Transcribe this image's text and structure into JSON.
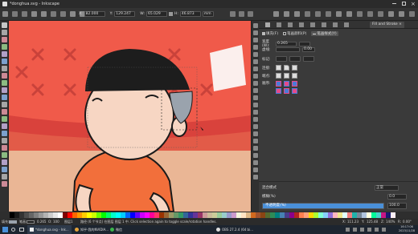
{
  "window": {
    "title": "*donghua.svg - Inkscape"
  },
  "command_bar": {
    "x_label": "X:",
    "x_value": "82.000",
    "y_label": "Y:",
    "y_value": "129.247",
    "w_label": "W:",
    "w_value": "65.029",
    "h_label": "H:",
    "h_value": "46.873",
    "unit": "mm"
  },
  "panel": {
    "tab_label": "Fill and Stroke",
    "fill_tab": "填充(F)",
    "stroke_paint_tab": "笔画颜料(P)",
    "stroke_style_tab": "笔画样式(Y)",
    "width_label": "宽度(W):",
    "width_value": "0.265",
    "dashes_label": "虚线:",
    "dashes_value": "0.00",
    "markers_label": "标记:",
    "join_label": "连接:",
    "cap_label": "端点:",
    "order_label": "顺序:",
    "blur_label": "模糊(%)",
    "blur_value": "0.0",
    "opacity_label": "不透明度(%)",
    "opacity_value": "100.0",
    "opacity_fill": 1.0,
    "blend_label": "混合模式",
    "blend_value": "正常"
  },
  "statusbar": {
    "fill_label": "填充:",
    "stroke_label": "笔画:",
    "stroke_width": "0.265",
    "opacity_label": "O:",
    "opacity_value": "100",
    "layer": "图层1",
    "message": "路径 (6 个节点) 在图层 图层 1 中. Click selection again to toggle scale/rotation handles.",
    "cursor_x_label": "X:",
    "cursor_x": "111.23",
    "cursor_y_label": "Y:",
    "cursor_y": "125.48",
    "zoom_label": "Z:",
    "zoom": "140%",
    "rotation_label": "R:",
    "rotation": "0.00°"
  },
  "taskbar": {
    "items": [
      "*donghua.svg - Ink...",
      "知乎-我的NVIDIA...",
      "微信",
      "OBS 27.2.4 (64 bi..."
    ],
    "time": "16:17:06",
    "date": "2023/11/28"
  },
  "colors": {
    "title_bg": "#2b2b2b",
    "panel_bg": "#3a3a3a",
    "accent": "#4a90d9",
    "wall_red": "#f05a4a",
    "hair": "#1d1d1d",
    "skin": "#f7d6c3",
    "shirt": "#f26f3b"
  },
  "palette_swatches": [
    "#000000",
    "#1a1a1a",
    "#333333",
    "#4d4d4d",
    "#666666",
    "#808080",
    "#999999",
    "#b3b3b3",
    "#cccccc",
    "#e6e6e6",
    "#ffffff",
    "#800000",
    "#ff0000",
    "#ff6600",
    "#ff9900",
    "#ffcc00",
    "#ffff00",
    "#ccff00",
    "#66ff00",
    "#00ff00",
    "#00ff66",
    "#00ffcc",
    "#00ffff",
    "#00ccff",
    "#0066ff",
    "#0000ff",
    "#6600ff",
    "#cc00ff",
    "#ff00ff",
    "#ff0099",
    "#ff3366",
    "#993300",
    "#996633",
    "#999966",
    "#669966",
    "#339966",
    "#336699",
    "#333399",
    "#663399",
    "#993366",
    "#cc9999",
    "#ccbb99",
    "#cccc99",
    "#99cc99",
    "#99cccc",
    "#9999cc",
    "#cc99cc",
    "#f5f5dc",
    "#ffe4c4",
    "#deb887",
    "#d2691e",
    "#a0522d",
    "#8b4513",
    "#556b2f",
    "#2e8b57",
    "#008080",
    "#4682b4",
    "#483d8b",
    "#8b008b",
    "#b22222",
    "#ff7f50",
    "#ffa07a",
    "#ffd700",
    "#adff2f",
    "#7fffd4",
    "#87cefa",
    "#9370db",
    "#ffb6c1",
    "#f0e68c",
    "#e0ffff",
    "#f08080",
    "#20b2aa",
    "#778899",
    "#b0c4de",
    "#ffffe0",
    "#00fa9a",
    "#48d1cc",
    "#c71585",
    "#191970",
    "#fff0f5"
  ],
  "tool_icons": [
    "selector-icon",
    "node-icon",
    "tweak-icon",
    "zoom-icon",
    "measure-icon",
    "rect-icon",
    "box3d-icon",
    "ellipse-icon",
    "star-icon",
    "spiral-icon",
    "pencil-icon",
    "pen-icon",
    "calligraphy-icon",
    "text-icon",
    "spray-icon",
    "eraser-icon",
    "bucket-icon",
    "gradient-icon",
    "mesh-icon",
    "dropper-icon",
    "connector-icon",
    "lpe-icon",
    "pages-icon"
  ]
}
